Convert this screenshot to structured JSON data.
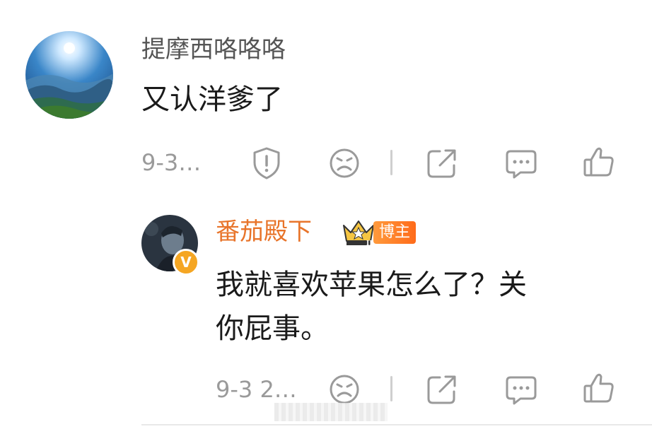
{
  "comment1": {
    "username": "提摩西咯咯咯",
    "text": "又认洋爹了",
    "time": "9-3…",
    "icons": [
      "report-icon",
      "sad-face-icon",
      "share-icon",
      "comment-icon",
      "like-icon"
    ]
  },
  "comment2": {
    "username": "番茄殿下",
    "badge_label": "博主",
    "verified_mark": "V",
    "text_line1": "我就喜欢苹果怎么了？关",
    "text_line2": "你屁事。",
    "time": "9-3 2…",
    "icons": [
      "sad-face-icon",
      "share-icon",
      "comment-icon",
      "like-icon"
    ]
  },
  "colors": {
    "username_gray": "#555555",
    "username_orange": "#e8742a",
    "meta_gray": "#9a9a9a",
    "icon_gray": "#9a9a9a"
  }
}
